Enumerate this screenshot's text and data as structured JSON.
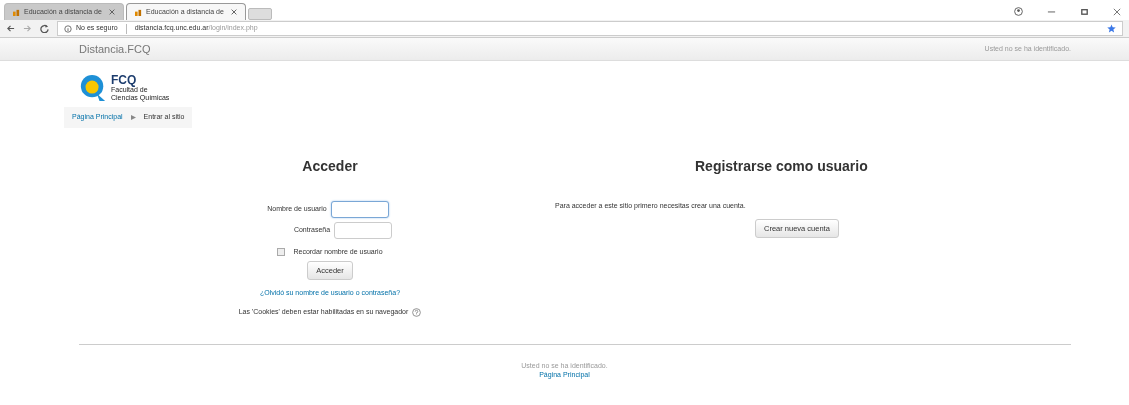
{
  "browser": {
    "tabs": [
      {
        "label": "Educación a distancia de",
        "selected": false
      },
      {
        "label": "Educación a distancia de",
        "selected": true
      }
    ],
    "address": {
      "security": "No es seguro",
      "host": "distancia.fcq.unc.edu.ar",
      "path": "/login/index.php"
    }
  },
  "navbar": {
    "brand": "Distancia.FCQ",
    "login_info": "Usted no se ha identificado."
  },
  "logo": {
    "name": "FCQ",
    "subtitle_1": "Facultad de",
    "subtitle_2": "Ciencias Químicas"
  },
  "breadcrumb": [
    {
      "label": "Página Principal",
      "kind": "link"
    },
    {
      "label": "Entrar al sitio",
      "kind": "text"
    }
  ],
  "login": {
    "title": "Acceder",
    "username_label": "Nombre de usuario",
    "password_label": "Contraseña",
    "remember": {
      "label": "Recordar nombre de usuario",
      "checked": false
    },
    "button": "Acceder",
    "forgot": "¿Olvidó su nombre de usuario o contraseña?",
    "cookies": "Las 'Cookies' deben estar habilitadas en su navegador"
  },
  "signup": {
    "title": "Registrarse como usuario",
    "text": "Para acceder a este sitio primero necesitas crear una cuenta.",
    "button": "Crear nueva cuenta"
  },
  "footer": {
    "login_info": "Usted no se ha identificado.",
    "home_link": "Página Principal"
  }
}
